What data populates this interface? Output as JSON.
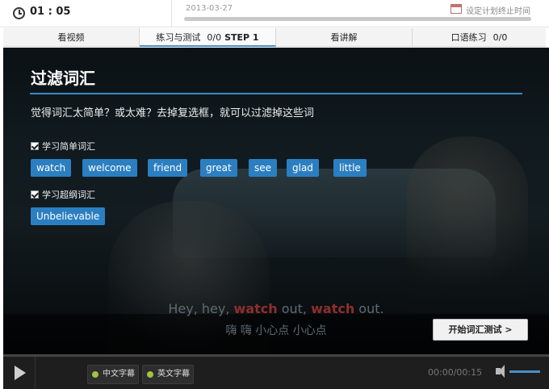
{
  "header": {
    "timer": "01 : 05",
    "plan_date": "2013-03-27",
    "plan_link": "设定计划终止时间"
  },
  "tabs": [
    {
      "label": "看视频"
    },
    {
      "label": "练习与测试",
      "count": "0/0",
      "step": "STEP 1"
    },
    {
      "label": "看讲解"
    },
    {
      "label": "口语练习",
      "count": "0/0"
    }
  ],
  "panel": {
    "title": "过滤词汇",
    "description": "觉得词汇太简单？或太难？去掉复选框，就可以过滤掉这些词",
    "simple_label": "学习简单词汇",
    "simple_words": [
      "watch",
      "welcome",
      "friend",
      "great",
      "see",
      "glad",
      "little"
    ],
    "hard_label": "学习超纲词汇",
    "hard_words": [
      "Unbelievable"
    ]
  },
  "subtitle": {
    "en_parts": [
      "Hey, hey, ",
      "watch",
      " out, ",
      "watch",
      " out."
    ],
    "zh": "嗨 嗨 小心点 小心点"
  },
  "start_test_label": "开始词汇测试 >",
  "player": {
    "sub_zh": "中文字幕",
    "sub_en": "英文字幕",
    "time": "00:00/00:15",
    "volume_percent": 100
  },
  "colors": {
    "accent": "#2b7fc1",
    "highlight_word": "#8e2f2a"
  },
  "icons": {
    "timer": "clock-icon",
    "plan": "calendar-icon",
    "play": "play-icon",
    "volume": "volume-icon"
  }
}
